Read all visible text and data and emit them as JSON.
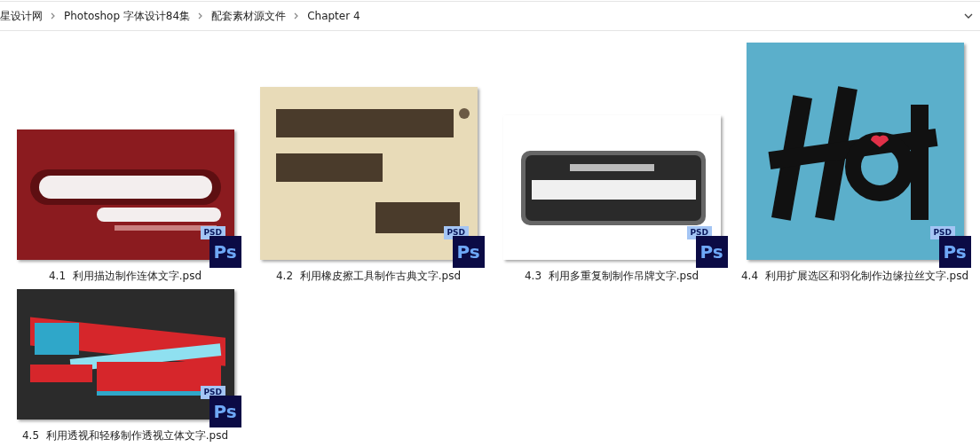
{
  "address_bar": {
    "breadcrumbs": [
      "星设计网",
      "Photoshop 字体设计84集",
      "配套素材源文件",
      "Chapter 4"
    ]
  },
  "files": [
    {
      "name": "4.1  利用描边制作连体文字.psd",
      "type_tag": "PSD",
      "app_tile": "Ps"
    },
    {
      "name": "4.2  利用橡皮擦工具制作古典文字.psd",
      "type_tag": "PSD",
      "app_tile": "Ps"
    },
    {
      "name": "4.3  利用多重复制制作吊牌文字.psd",
      "type_tag": "PSD",
      "app_tile": "Ps"
    },
    {
      "name": "4.4  利用扩展选区和羽化制作边缘拉丝文字.psd",
      "type_tag": "PSD",
      "app_tile": "Ps"
    },
    {
      "name": "4.5  利用透视和轻移制作透视立体文字.psd",
      "type_tag": "PSD",
      "app_tile": "Ps"
    }
  ]
}
